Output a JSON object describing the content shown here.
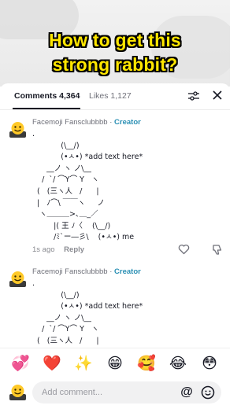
{
  "video": {
    "headline_line1": "How to get this",
    "headline_line2": "strong rabbit?"
  },
  "tabs": {
    "comments_label": "Comments 4,364",
    "likes_label": "Likes 1,127"
  },
  "comments": [
    {
      "username": "Facemoji Fansclubbbb",
      "separator": "·",
      "badge": "Creator",
      "art": ".\n            (\\__/)\n            (•ㅅ•) *add text here*\n      __ノ ヽ ノ\\__\n    /  `/ ⌒Y⌒ Y   ヽ\n  (   (三ヽ人   /      |\n  |   ﾉ⌒\\ ￣￣ヽ     ノ\n   ヽ＿＿＿>､＿_／\n         |( 王 ﾉ〈    (\\__/)\n         /ﾐ`ー―彡\\    (•ㅅ•) me",
      "time": "1s ago",
      "reply_label": "Reply"
    },
    {
      "username": "Facemoji Fansclubbbb",
      "separator": "·",
      "badge": "Creator",
      "art": ".\n            (\\__/)\n            (•ㅅ•) *add text here*\n      __ノ ヽ ノ\\__\n    /  `/ ⌒Y⌒ Y   ヽ\n  (   (三ヽ人   /      |"
    }
  ],
  "emoji_bar": [
    "💞",
    "❤️",
    "✨",
    "😁",
    "🥰",
    "😂",
    "😳"
  ],
  "comment_input": {
    "placeholder": "Add comment...",
    "at_symbol": "@"
  },
  "colors": {
    "headline_yellow": "#ffe600",
    "creator_blue": "#2a8fb4"
  }
}
